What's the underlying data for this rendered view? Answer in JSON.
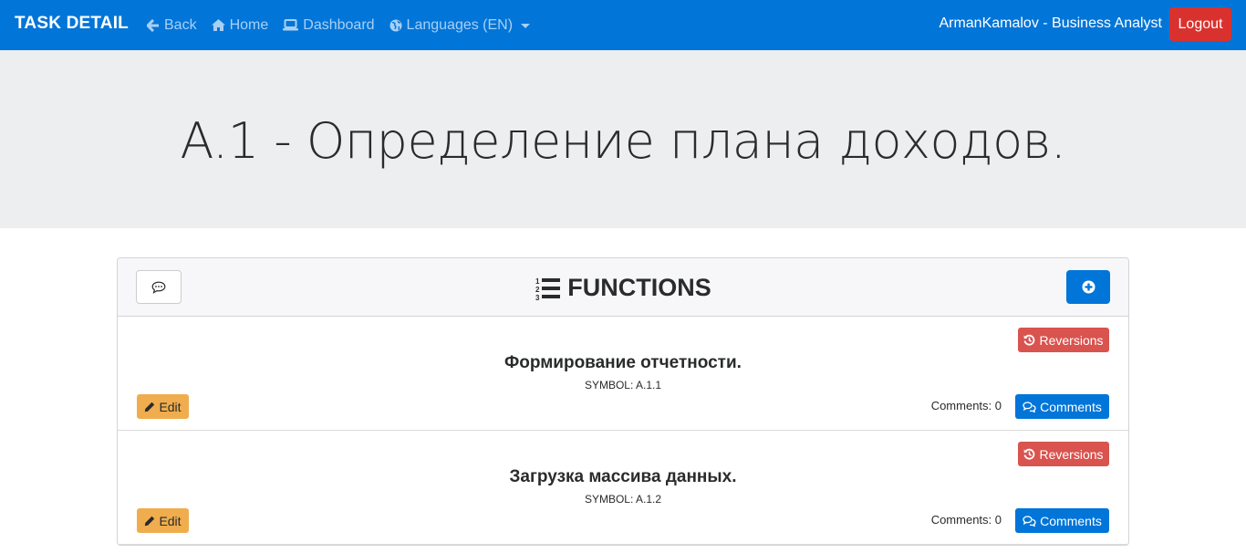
{
  "navbar": {
    "brand": "TASK DETAIL",
    "links": [
      {
        "label": "Back",
        "icon": "arrow-left-icon"
      },
      {
        "label": "Home",
        "icon": "home-icon"
      },
      {
        "label": "Dashboard",
        "icon": "laptop-icon"
      },
      {
        "label": "Languages (EN)",
        "icon": "globe-icon"
      }
    ],
    "user": "ArmanKamalov - Business Analyst",
    "logout_label": "Logout"
  },
  "page": {
    "title": "A.1 - Определение плана доходов."
  },
  "functions": {
    "header_title": "FUNCTIONS",
    "header_icon": "list-ol-icon",
    "items": [
      {
        "title": "Формирование отчетности.",
        "symbol": "SYMBOL: A.1.1",
        "reversions_label": "Reversions",
        "edit_label": "Edit",
        "comments_count": "Comments: 0",
        "comments_label": "Comments"
      },
      {
        "title": "Загрузка массива данных.",
        "symbol": "SYMBOL: A.1.2",
        "reversions_label": "Reversions",
        "edit_label": "Edit",
        "comments_count": "Comments: 0",
        "comments_label": "Comments"
      }
    ]
  },
  "colors": {
    "primary": "#0275d8",
    "danger": "#d9534f",
    "warning": "#f0ad4e",
    "logout": "#d9322e",
    "jumbotron": "#eceeef"
  }
}
